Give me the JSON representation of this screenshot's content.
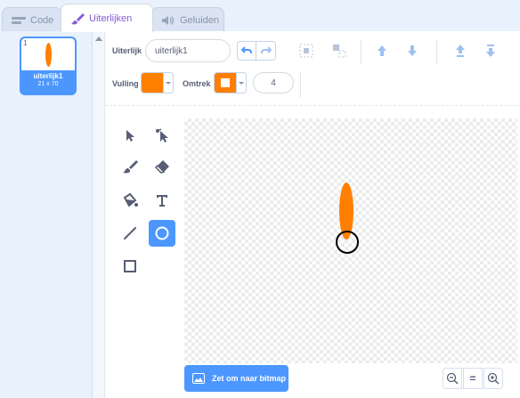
{
  "tabs": [
    {
      "label": "Code",
      "icon": "code-blocks-icon"
    },
    {
      "label": "Uiterlijken",
      "icon": "paintbrush-icon"
    },
    {
      "label": "Geluiden",
      "icon": "speaker-icon"
    }
  ],
  "costume_list": {
    "items": [
      {
        "number": "1",
        "name": "uiterlijk1",
        "size": "21 x 70",
        "selected": true
      }
    ]
  },
  "toolbar": {
    "costume_label": "Uiterlijk",
    "costume_name": "uiterlijk1",
    "fill_label": "Vulling",
    "fill_color": "#ff7f00",
    "outline_label": "Omtrek",
    "outline_color": "#ff7f00",
    "stroke_width": "4"
  },
  "tools": [
    {
      "name": "select-tool",
      "icon": "arrow-pointer-icon"
    },
    {
      "name": "reshape-tool",
      "icon": "reshape-pointer-icon"
    },
    {
      "name": "brush-tool",
      "icon": "brush-icon"
    },
    {
      "name": "eraser-tool",
      "icon": "eraser-icon"
    },
    {
      "name": "fill-tool",
      "icon": "paint-bucket-icon"
    },
    {
      "name": "text-tool",
      "icon": "text-t-icon"
    },
    {
      "name": "line-tool",
      "icon": "line-icon"
    },
    {
      "name": "circle-tool",
      "icon": "circle-icon",
      "active": true
    },
    {
      "name": "rectangle-tool",
      "icon": "square-icon"
    }
  ],
  "canvas": {
    "shape_color": "#ff7f00",
    "cursor_icon": "circle-cursor-icon"
  },
  "bottom": {
    "bitmap_button_label": "Zet om naar bitmap",
    "zoom_out_icon": "zoom-out-icon",
    "zoom_reset_label": "=",
    "zoom_in_icon": "zoom-in-icon"
  },
  "colors": {
    "accent": "#4c97ff",
    "active_tab_text": "#855cd6"
  }
}
